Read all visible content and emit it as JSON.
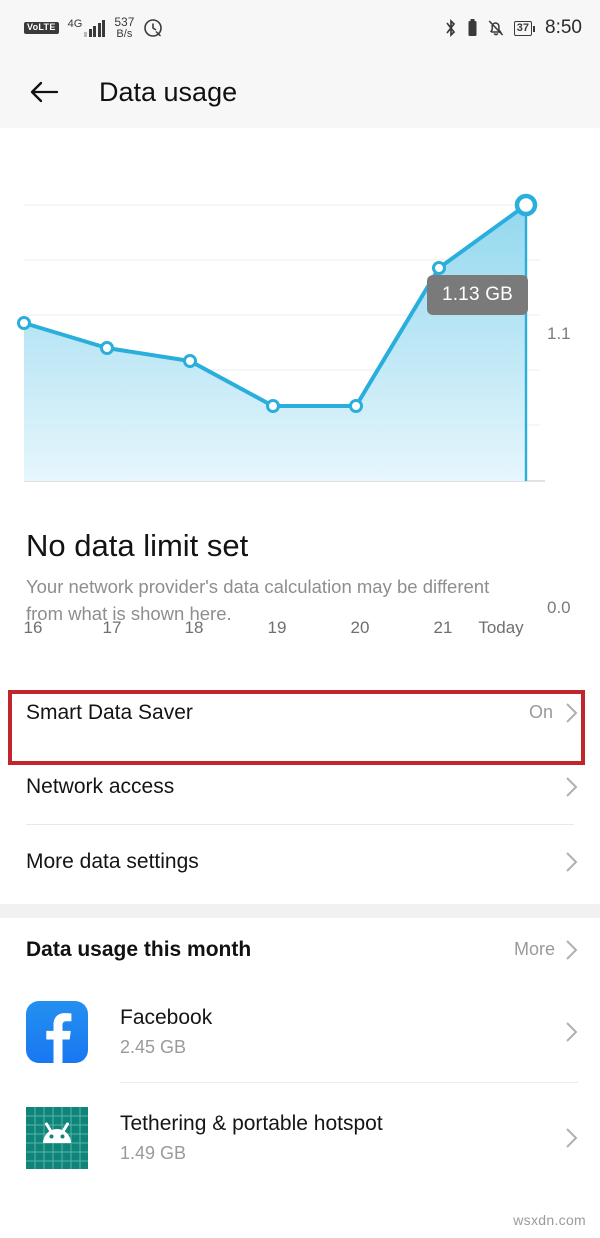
{
  "status_bar": {
    "volte_label": "VoLTE",
    "network_gen": "4G",
    "speed_value": "537",
    "speed_unit": "B/s",
    "icons_left": [
      "volte-icon",
      "signal-bars-icon",
      "data-speed-indicator",
      "alarm-icon"
    ],
    "icons_right": [
      "bluetooth-icon",
      "battery-body-icon",
      "mute-bell-icon",
      "battery-percent-icon"
    ],
    "battery_percent": "37",
    "time": "8:50"
  },
  "app_bar": {
    "back_icon": "back-arrow-icon",
    "title": "Data usage"
  },
  "chart_data": {
    "type": "area",
    "title": "",
    "xlabel": "",
    "ylabel": "",
    "categories": [
      "16",
      "17",
      "18",
      "19",
      "20",
      "21",
      "Today"
    ],
    "values": [
      0.63,
      0.53,
      0.48,
      0.3,
      0.3,
      0.85,
      1.13
    ],
    "ylim": [
      0.0,
      1.1
    ],
    "ytick_labels": [
      "1.1",
      "0.0"
    ],
    "grid": true,
    "legend": "none",
    "highlight_point": {
      "category": "Today",
      "value": 1.13,
      "tooltip": "1.13 GB"
    },
    "series_color": "#2aaedc",
    "fill_color_top": "#9fdcf0",
    "fill_color_bottom": "#e4f5fb"
  },
  "summary": {
    "headline": "No data limit set",
    "subtext": "Your network provider's data calculation may be different from what is shown here."
  },
  "settings_rows": [
    {
      "label": "Smart Data Saver",
      "value": "On",
      "chevron": "chevron-right-icon",
      "highlighted": true
    },
    {
      "label": "Network access",
      "value": "",
      "chevron": "chevron-right-icon",
      "highlighted": false
    },
    {
      "label": "More data settings",
      "value": "",
      "chevron": "chevron-right-icon",
      "highlighted": false
    }
  ],
  "this_month": {
    "title": "Data usage this month",
    "more_label": "More",
    "more_chevron": "chevron-right-icon",
    "apps": [
      {
        "name": "Facebook",
        "size": "2.45 GB",
        "icon": "facebook-icon",
        "chevron": "chevron-right-icon"
      },
      {
        "name": "Tethering & portable hotspot",
        "size": "1.49 GB",
        "icon": "android-tethering-icon",
        "chevron": "chevron-right-icon"
      }
    ]
  },
  "watermark": "wsxdn.com",
  "colors": {
    "accent": "#2aaedc",
    "highlight_border": "#c0272d",
    "facebook_blue": "#1877f2",
    "android_teal": "#0f8478",
    "tooltip_bg": "#7a7a7a"
  }
}
